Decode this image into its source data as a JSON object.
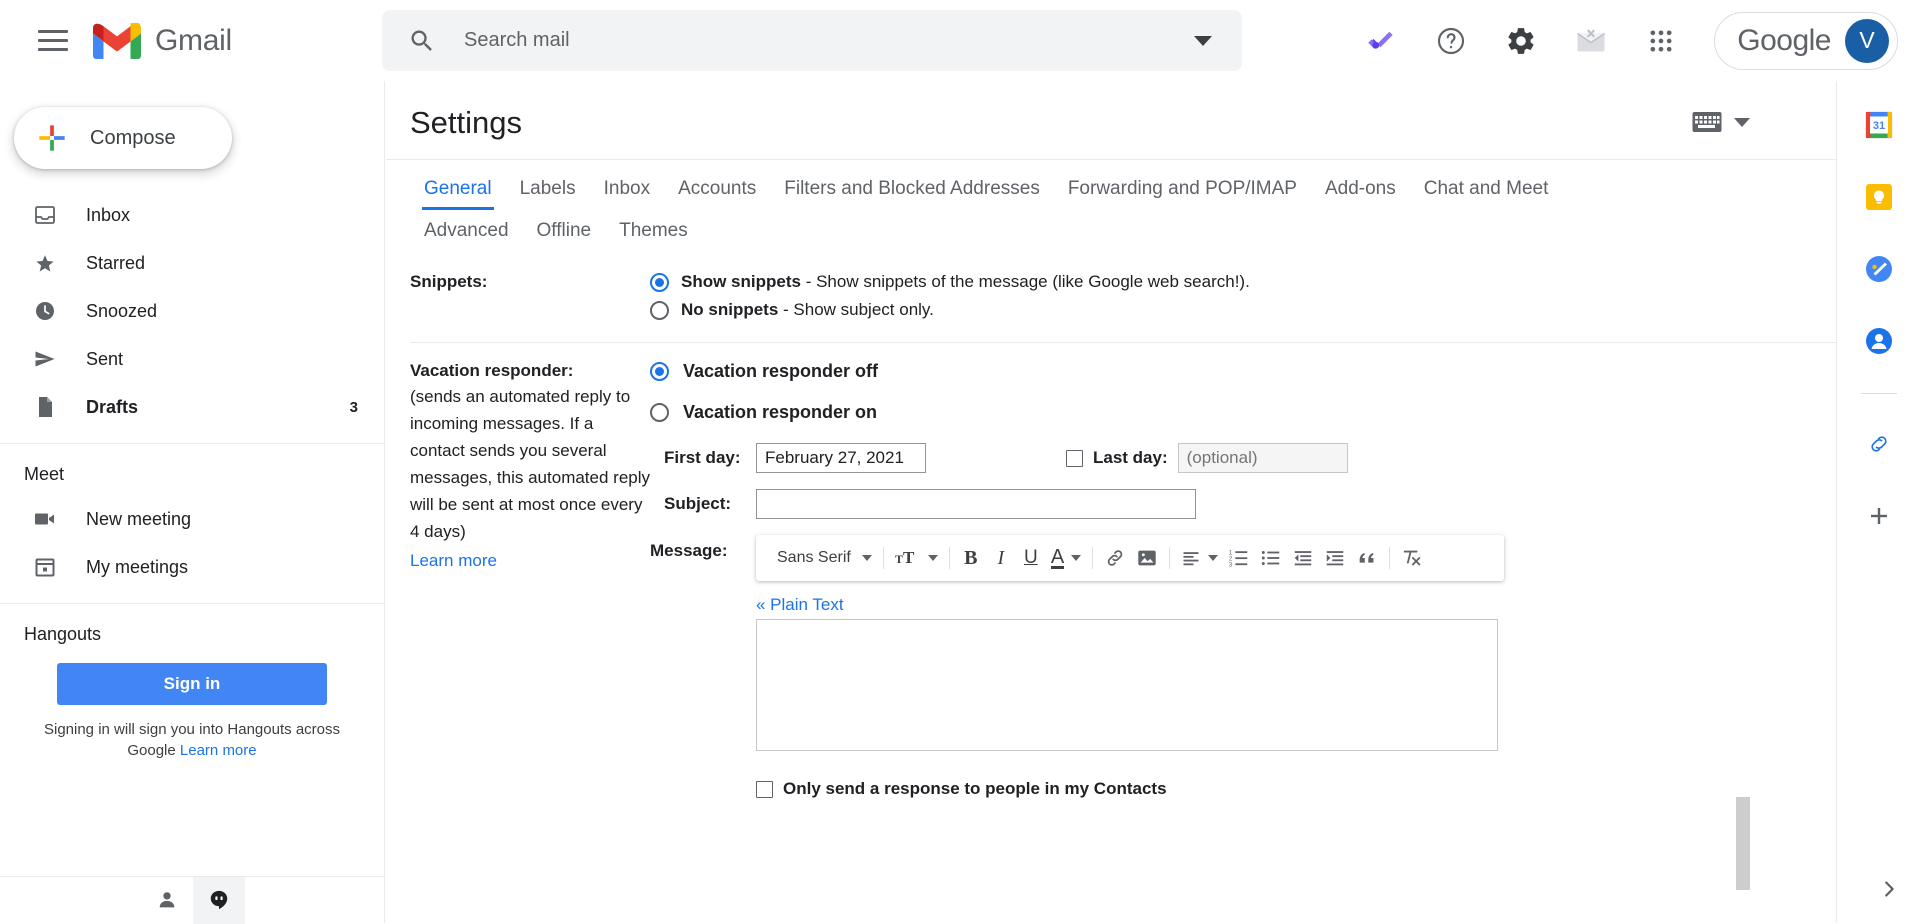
{
  "topbar": {
    "menu_icon": "hamburger-icon",
    "brand": "Gmail",
    "search": {
      "placeholder": "Search mail",
      "value": "",
      "icon": "search-icon",
      "options_icon": "chevron-down-icon"
    },
    "icons": [
      {
        "name": "tasks-checkmark-icon",
        "color": "#7c5cfa"
      },
      {
        "name": "help-icon",
        "color": "#5f6368"
      },
      {
        "name": "settings-gear-icon",
        "color": "#3c4043"
      },
      {
        "name": "unsubscribe-envelope-icon",
        "color": "#bdc1c6"
      },
      {
        "name": "google-apps-grid-icon",
        "color": "#5f6368"
      }
    ],
    "account": {
      "label": "Google",
      "avatar_initial": "V",
      "avatar_color": "#1a5fa5"
    }
  },
  "sidebar": {
    "compose": {
      "label": "Compose",
      "icon": "plus-icon"
    },
    "items": [
      {
        "label": "Inbox",
        "icon": "inbox-icon",
        "count": "",
        "bold": false
      },
      {
        "label": "Starred",
        "icon": "star-icon",
        "count": "",
        "bold": false
      },
      {
        "label": "Snoozed",
        "icon": "clock-icon",
        "count": "",
        "bold": false
      },
      {
        "label": "Sent",
        "icon": "send-icon",
        "count": "",
        "bold": false
      },
      {
        "label": "Drafts",
        "icon": "draft-file-icon",
        "count": "3",
        "bold": true
      }
    ],
    "meet": {
      "title": "Meet",
      "items": [
        {
          "label": "New meeting",
          "icon": "video-camera-icon"
        },
        {
          "label": "My meetings",
          "icon": "calendar-icon"
        }
      ]
    },
    "hangouts": {
      "title": "Hangouts",
      "signin_label": "Sign in",
      "note_line1": "Signing in will sign you into Hangouts",
      "note_line2": "across Google",
      "learn_more": "Learn more"
    },
    "footer_icons": [
      {
        "name": "person-icon",
        "active": false
      },
      {
        "name": "hangouts-chat-icon",
        "active": true
      }
    ]
  },
  "main": {
    "title": "Settings",
    "keyboard_icon": "keyboard-icon",
    "tabs_row1": [
      {
        "label": "General",
        "active": true
      },
      {
        "label": "Labels",
        "active": false
      },
      {
        "label": "Inbox",
        "active": false
      },
      {
        "label": "Accounts",
        "active": false
      },
      {
        "label": "Filters and Blocked Addresses",
        "active": false
      },
      {
        "label": "Forwarding and POP/IMAP",
        "active": false
      },
      {
        "label": "Add-ons",
        "active": false
      },
      {
        "label": "Chat and Meet",
        "active": false
      }
    ],
    "tabs_row2": [
      {
        "label": "Advanced",
        "active": false
      },
      {
        "label": "Offline",
        "active": false
      },
      {
        "label": "Themes",
        "active": false
      }
    ],
    "snippets": {
      "label": "Snippets:",
      "option1_bold": "Show snippets",
      "option1_rest": " - Show snippets of the message (like Google web search!).",
      "option1_checked": true,
      "option2_bold": "No snippets",
      "option2_rest": " - Show subject only.",
      "option2_checked": false
    },
    "vacation": {
      "label": "Vacation responder:",
      "description": "(sends an automated reply to incoming messages. If a contact sends you several messages, this automated reply will be sent at most once every 4 days)",
      "learn_more": "Learn more",
      "option_off": "Vacation responder off",
      "option_off_checked": true,
      "option_on": "Vacation responder on",
      "option_on_checked": false,
      "first_day_label": "First day:",
      "first_day_value": "February 27, 2021",
      "last_day_label": "Last day:",
      "last_day_checked": false,
      "last_day_placeholder": "(optional)",
      "last_day_value": "",
      "subject_label": "Subject:",
      "subject_value": "",
      "message_label": "Message:",
      "plain_text_link": "« Plain Text",
      "message_value": "",
      "contacts_only_label": "Only send a response to people in my Contacts",
      "contacts_only_checked": false
    },
    "editor_toolbar": {
      "font_name": "Sans Serif",
      "buttons": [
        {
          "name": "font-family-dropdown",
          "label": "Sans Serif"
        },
        {
          "name": "font-size-icon",
          "label": "TT"
        },
        {
          "name": "bold-icon",
          "label": "B"
        },
        {
          "name": "italic-icon",
          "label": "I"
        },
        {
          "name": "underline-icon",
          "label": "U"
        },
        {
          "name": "text-color-icon",
          "label": "A"
        },
        {
          "name": "insert-link-icon",
          "label": "link"
        },
        {
          "name": "insert-image-icon",
          "label": "image"
        },
        {
          "name": "align-icon",
          "label": "align"
        },
        {
          "name": "numbered-list-icon",
          "label": "numlist"
        },
        {
          "name": "bulleted-list-icon",
          "label": "bullist"
        },
        {
          "name": "outdent-icon",
          "label": "outdent"
        },
        {
          "name": "indent-icon",
          "label": "indent"
        },
        {
          "name": "quote-icon",
          "label": "quote"
        },
        {
          "name": "remove-formatting-icon",
          "label": "clearformat"
        }
      ]
    }
  },
  "rail": {
    "icons": [
      {
        "name": "google-calendar-icon",
        "badge": "31"
      },
      {
        "name": "google-keep-icon",
        "badge": ""
      },
      {
        "name": "google-tasks-icon",
        "badge": ""
      },
      {
        "name": "google-contacts-icon",
        "badge": ""
      }
    ],
    "addon_icon": "addon-link-icon",
    "add_icon": "plus-icon",
    "expand_icon": "chevron-right-icon"
  }
}
